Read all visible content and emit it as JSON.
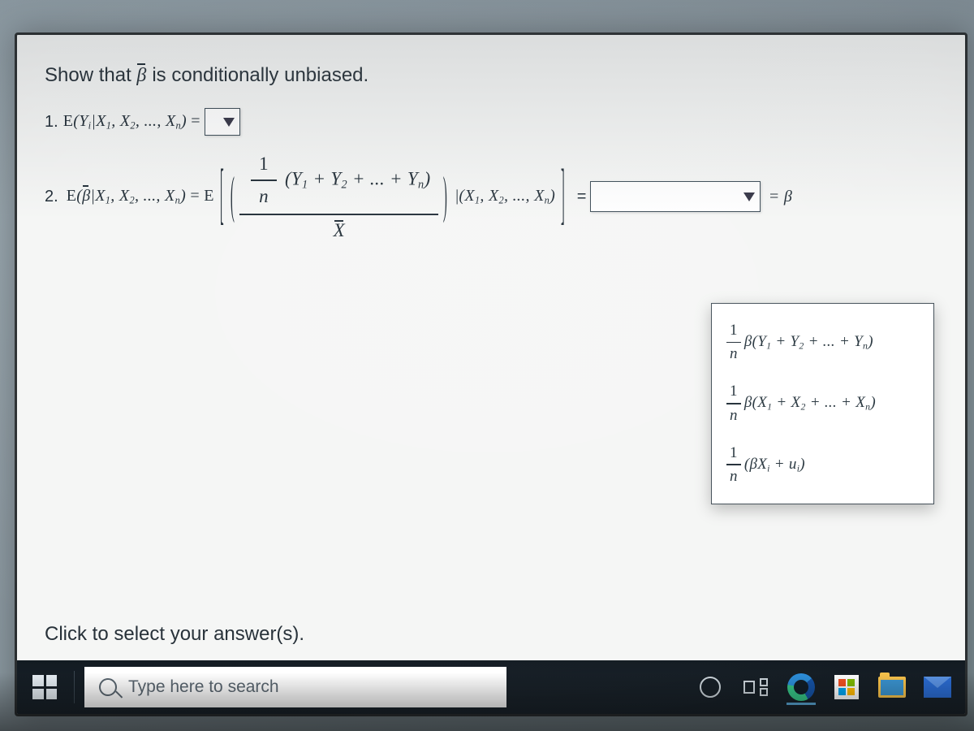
{
  "problem": {
    "prompt_prefix": "Show that ",
    "prompt_suffix": " is conditionally unbiased.",
    "beta_hat_symbol": "β",
    "items": {
      "1": {
        "number": "1.",
        "lhs_Y": "Y",
        "lhs_i": "i",
        "given": "X",
        "subs": [
          "1",
          "2",
          "n"
        ],
        "dropdown_value": ""
      },
      "2": {
        "number": "2.",
        "given": "X",
        "subs": [
          "1",
          "2",
          "n"
        ],
        "fraction_num_prefix": "(Y",
        "fraction_num_mid": " + Y",
        "fraction_num_end": " + ... + Y",
        "fraction_num_close": ")",
        "fraction_one": "1",
        "fraction_n": "n",
        "denom": "X",
        "indicator_prefix": "(X",
        "indicator_mid": ", X",
        "indicator_end": ", ..., X",
        "indicator_close": ")",
        "equals": "= ",
        "rhs_suffix": "= β",
        "dropdown_value": ""
      }
    }
  },
  "dropdown_options": {
    "opt1": {
      "one": "1",
      "n": "n",
      "beta": "β",
      "open": "(Y",
      "mid": " + Y",
      "end": " + ... + Y",
      "close": ")",
      "subs": [
        "1",
        "2",
        "n"
      ]
    },
    "opt2": {
      "one": "1",
      "n": "n",
      "beta": "β",
      "open": "(X",
      "mid": " + X",
      "end": " + ... + X",
      "close": ")",
      "subs": [
        "1",
        "2",
        "n"
      ]
    },
    "opt3": {
      "one": "1",
      "n": "n",
      "open": "(βX",
      "plus": " + u",
      "close": ")",
      "sub_i": "i"
    }
  },
  "footer_hint": "Click to select your answer(s).",
  "taskbar": {
    "search_placeholder": "Type here to search"
  }
}
